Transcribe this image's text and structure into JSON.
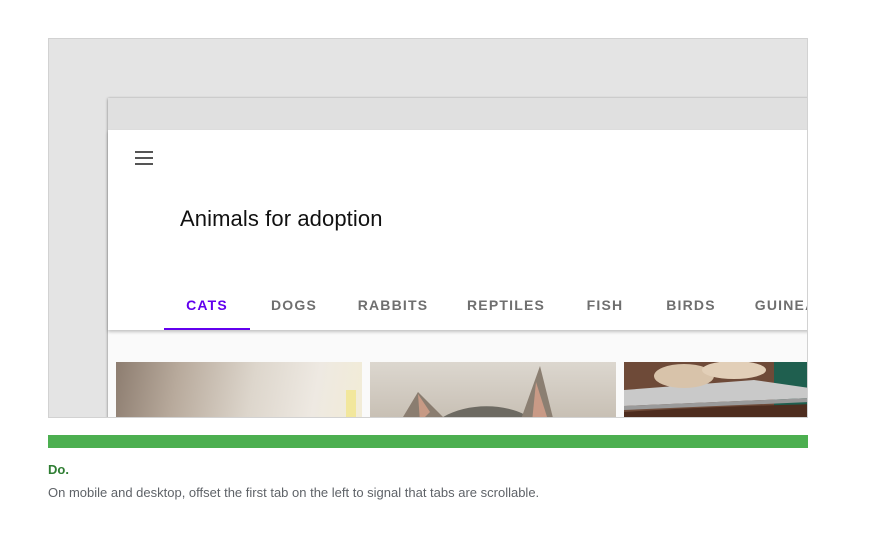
{
  "app": {
    "title": "Animals for adoption"
  },
  "tabs": [
    {
      "label": "CATS",
      "active": true
    },
    {
      "label": "DOGS",
      "active": false
    },
    {
      "label": "RABBITS",
      "active": false
    },
    {
      "label": "REPTILES",
      "active": false
    },
    {
      "label": "FISH",
      "active": false
    },
    {
      "label": "BIRDS",
      "active": false
    },
    {
      "label": "GUINEA PIGS",
      "active": false
    }
  ],
  "icons": {
    "menu": "menu-icon"
  },
  "colors": {
    "accent": "#6200ee",
    "tab_inactive": "#6f6f6f",
    "guideline_do": "#4caf50",
    "guideline_do_text": "#2e7d32"
  },
  "guideline": {
    "label": "Do.",
    "text": "On mobile and desktop, offset the first tab on the left to signal that tabs are scrollable."
  }
}
